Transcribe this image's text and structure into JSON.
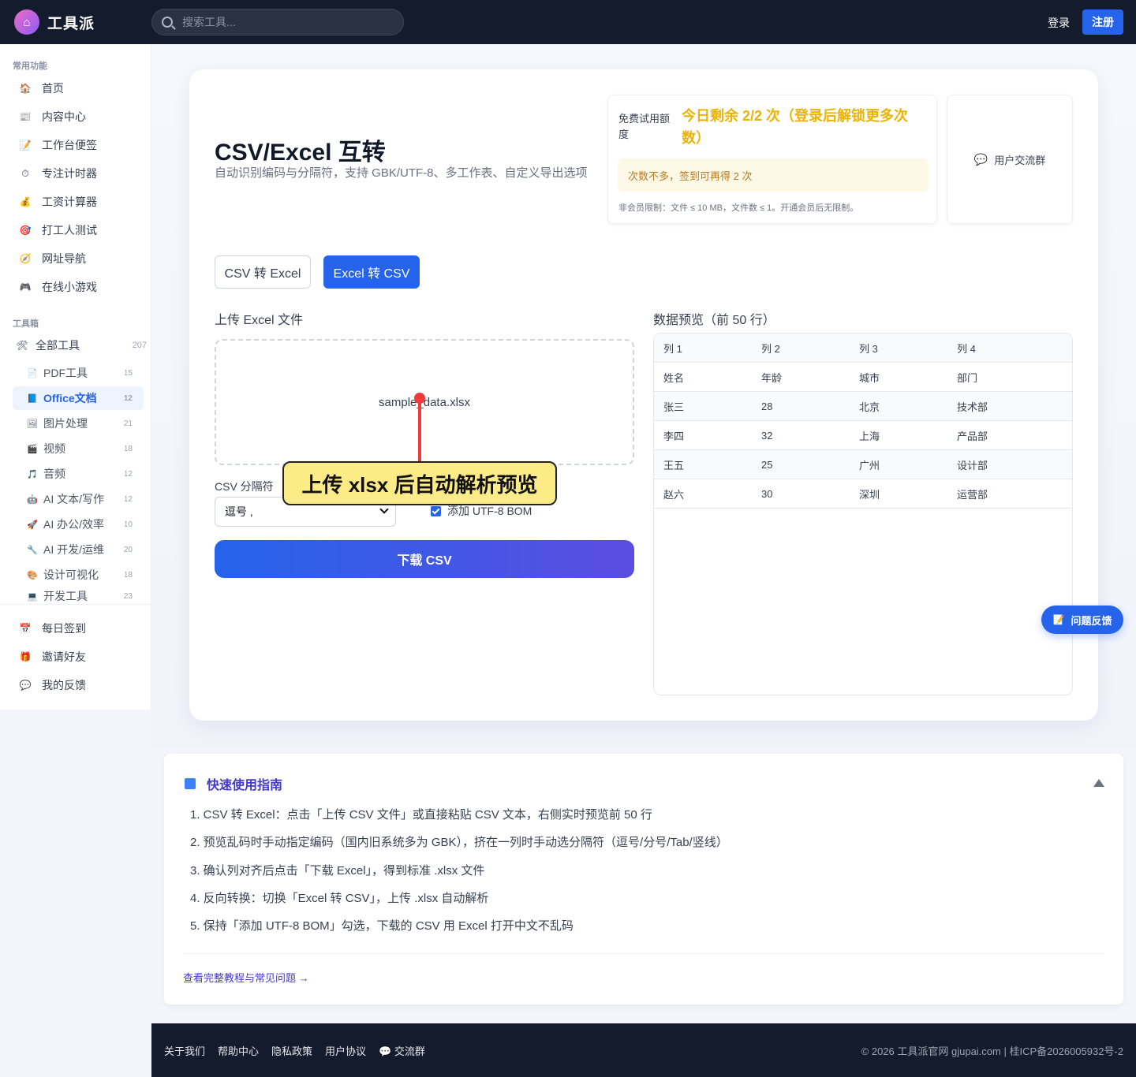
{
  "app": {
    "name": "工具派",
    "logo_icon": "bag-icon"
  },
  "header": {
    "search_placeholder": "搜索工具...",
    "login_label": "登录",
    "register_label": "注册"
  },
  "sidebar": {
    "section_common": "常用功能",
    "common_items": [
      {
        "label": "首页",
        "icon": "🏠"
      },
      {
        "label": "内容中心",
        "icon": "📰"
      },
      {
        "label": "工作台便签",
        "icon": "📝"
      },
      {
        "label": "专注计时器",
        "icon": "⏱"
      },
      {
        "label": "工资计算器",
        "icon": "💰"
      },
      {
        "label": "打工人测试",
        "icon": "🎯"
      },
      {
        "label": "网址导航",
        "icon": "🧭"
      },
      {
        "label": "在线小游戏",
        "icon": "🎮"
      }
    ],
    "section_tools": "工具箱",
    "all_tools": {
      "label": "全部工具",
      "count": "207",
      "icon": "🛠"
    },
    "tool_items": [
      {
        "label": "PDF工具",
        "count": "15",
        "icon": "📄"
      },
      {
        "label": "Office文档",
        "count": "12",
        "icon": "📘"
      },
      {
        "label": "图片处理",
        "count": "21",
        "icon": "🖼"
      },
      {
        "label": "视频",
        "count": "18",
        "icon": "🎬"
      },
      {
        "label": "音频",
        "count": "12",
        "icon": "🎵"
      },
      {
        "label": "AI 文本/写作",
        "count": "12",
        "icon": "🤖"
      },
      {
        "label": "AI 办公/效率",
        "count": "10",
        "icon": "🚀"
      },
      {
        "label": "AI 开发/运维",
        "count": "20",
        "icon": "🔧"
      },
      {
        "label": "设计可视化",
        "count": "18",
        "icon": "🎨"
      },
      {
        "label": "开发工具",
        "count": "23",
        "icon": "💻"
      }
    ],
    "bottom_items": [
      {
        "label": "每日签到",
        "icon": "📅"
      },
      {
        "label": "邀请好友",
        "icon": "🎁"
      },
      {
        "label": "我的反馈",
        "icon": "💬"
      }
    ]
  },
  "main": {
    "title": "CSV/Excel 互转",
    "subtitle": "自动识别编码与分隔符，支持 GBK/UTF-8、多工作表、自定义导出选项",
    "quota": {
      "label": "免费试用额度",
      "value": "今日剩余 2/2 次（登录后解锁更多次数）",
      "tip": "次数不多，签到可再得 2 次",
      "note": "非会员限制：文件 ≤ 10 MB，文件数 ≤ 1。开通会员后无限制。"
    },
    "group_label": "用户交流群",
    "tabs": [
      {
        "label": "CSV 转 Excel"
      },
      {
        "label": "Excel 转 CSV"
      }
    ],
    "upload_title": "上传 Excel 文件",
    "file_name": "sample_data.xlsx",
    "separator_label": "CSV 分隔符",
    "separator_value": "逗号 ,",
    "bom_label": "添加 UTF-8 BOM",
    "download_label": "下载 CSV",
    "annotation": "上传 xlsx 后自动解析预览",
    "preview_title": "数据预览（前 50 行）",
    "preview_header": [
      "列 1",
      "列 2",
      "列 3",
      "列 4"
    ],
    "preview_rows": [
      [
        "姓名",
        "年龄",
        "城市",
        "部门"
      ],
      [
        "张三",
        "28",
        "北京",
        "技术部"
      ],
      [
        "李四",
        "32",
        "上海",
        "产品部"
      ],
      [
        "王五",
        "25",
        "广州",
        "设计部"
      ],
      [
        "赵六",
        "30",
        "深圳",
        "运营部"
      ]
    ]
  },
  "guide": {
    "title": "快速使用指南",
    "steps": [
      "1. CSV 转 Excel：点击「上传 CSV 文件」或直接粘贴 CSV 文本，右侧实时预览前 50 行",
      "2. 预览乱码时手动指定编码（国内旧系统多为 GBK），挤在一列时手动选分隔符（逗号/分号/Tab/竖线）",
      "3. 确认列对齐后点击「下载 Excel」，得到标准 .xlsx 文件",
      "4. 反向转换：切换「Excel 转 CSV」，上传 .xlsx 自动解析",
      "5. 保持「添加 UTF-8 BOM」勾选，下载的 CSV 用 Excel 打开中文不乱码"
    ],
    "link": "查看完整教程与常见问题 →"
  },
  "feedback_label": "问题反馈",
  "footer": {
    "links": [
      "关于我们",
      "帮助中心",
      "隐私政策",
      "用户协议",
      "💬 交流群"
    ],
    "copyright": "© 2026 工具派官网 gjupai.com | 桂ICP备2026005932号-2"
  }
}
